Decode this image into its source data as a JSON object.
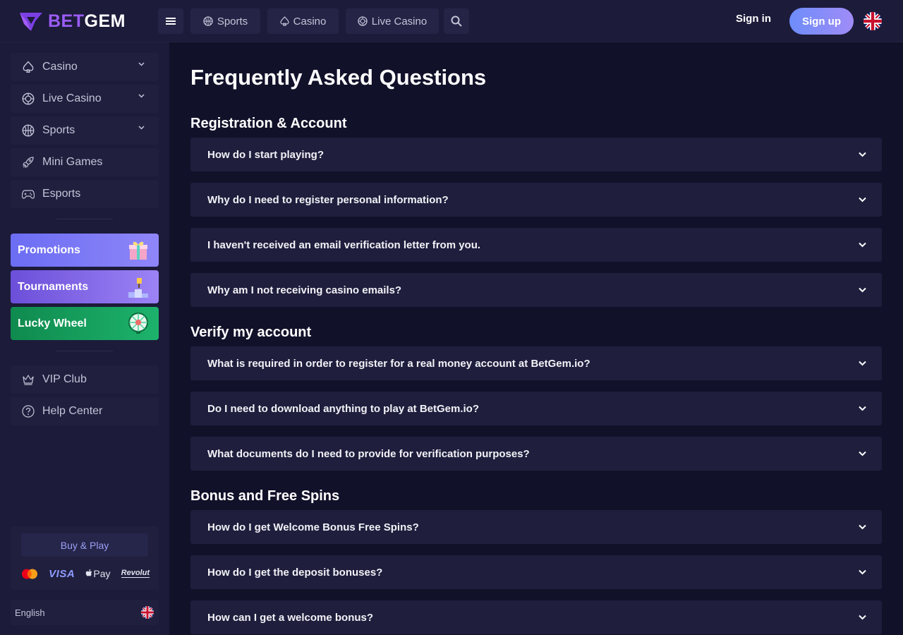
{
  "header": {
    "logo": {
      "part1": "BET",
      "part2": "GEM"
    },
    "nav": [
      {
        "label": "Sports",
        "icon": "basketball-icon"
      },
      {
        "label": "Casino",
        "icon": "spade-icon"
      },
      {
        "label": "Live Casino",
        "icon": "chip-icon"
      }
    ],
    "sign_in": "Sign in",
    "sign_up": "Sign up",
    "language_flag": "uk-flag-icon"
  },
  "sidebar": {
    "items": [
      {
        "label": "Casino",
        "icon": "spade-icon",
        "expandable": true
      },
      {
        "label": "Live Casino",
        "icon": "chip-icon",
        "expandable": true
      },
      {
        "label": "Sports",
        "icon": "basketball-icon",
        "expandable": true
      },
      {
        "label": "Mini Games",
        "icon": "rocket-icon",
        "expandable": false
      },
      {
        "label": "Esports",
        "icon": "gamepad-icon",
        "expandable": false
      }
    ],
    "promos": [
      {
        "label": "Promotions",
        "icon": "gift-icon",
        "color": "#6b6df4"
      },
      {
        "label": "Tournaments",
        "icon": "podium-icon",
        "color": "#6c4fd9"
      },
      {
        "label": "Lucky Wheel",
        "icon": "wheel-icon",
        "color": "#0f8a4e"
      }
    ],
    "bottom_items": [
      {
        "label": "VIP Club",
        "icon": "crown-icon"
      },
      {
        "label": "Help Center",
        "icon": "question-icon"
      }
    ],
    "buy_play": "Buy & Play",
    "payments": {
      "visa": "VISA",
      "apple_pay": "Pay",
      "revolut": "Revolut"
    },
    "language": "English"
  },
  "main": {
    "title": "Frequently Asked Questions",
    "sections": [
      {
        "title": "Registration & Account",
        "questions": [
          "How do I start playing?",
          "Why do I need to register personal information?",
          "I haven't received an email verification letter from you.",
          "Why am I not receiving casino emails?"
        ]
      },
      {
        "title": "Verify my account",
        "questions": [
          "What is required in order to register for a real money account at BetGem.io?",
          "Do I need to download anything to play at BetGem.io?",
          "What documents do I need to provide for verification purposes?"
        ]
      },
      {
        "title": "Bonus and Free Spins",
        "questions": [
          "How do I get Welcome Bonus Free Spins?",
          "How do I get the deposit bonuses?",
          "How can I get a welcome bonus?"
        ]
      }
    ]
  },
  "colors": {
    "background": "#12112a",
    "panel": "#1c1b3a",
    "card": "#1f1e3d",
    "accent": "#9b5cf6",
    "signup_gradient_start": "#6d8dfa",
    "signup_gradient_end": "#a08cf7"
  }
}
